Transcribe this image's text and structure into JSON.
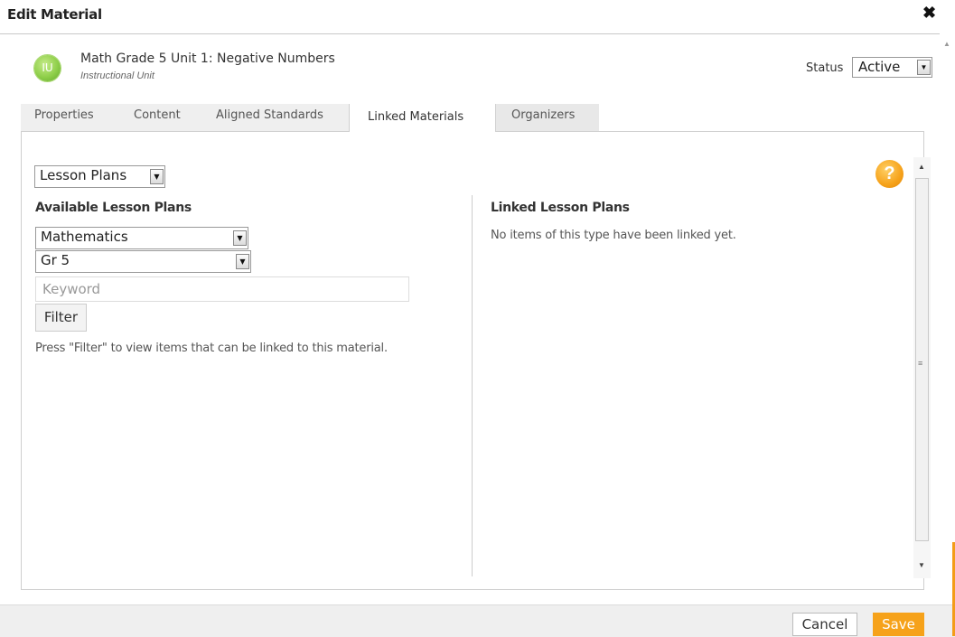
{
  "dialog": {
    "title": "Edit Material",
    "close_icon": "close-icon"
  },
  "material": {
    "avatar_text": "IU",
    "title": "Math Grade 5 Unit 1: Negative Numbers",
    "type": "Instructional Unit",
    "avatar_color": "#8fcf4a"
  },
  "status": {
    "label": "Status",
    "selected": "Active"
  },
  "tabs": [
    {
      "label": "Properties",
      "active": false
    },
    {
      "label": "Content",
      "active": false
    },
    {
      "label": "Aligned Standards",
      "active": false
    },
    {
      "label": "Linked Materials",
      "active": true
    },
    {
      "label": "Organizers",
      "active": false
    }
  ],
  "linked_materials": {
    "type_select": "Lesson Plans",
    "help_icon": "help-icon",
    "available": {
      "title": "Available Lesson Plans",
      "subject_select": "Mathematics",
      "grade_select": "Gr 5",
      "keyword_placeholder": "Keyword",
      "keyword_value": "",
      "filter_label": "Filter",
      "hint": "Press \"Filter\" to view items that can be linked to this material."
    },
    "linked": {
      "title": "Linked Lesson Plans",
      "empty_message": "No items of this type have been linked yet."
    }
  },
  "footer": {
    "cancel_label": "Cancel",
    "save_label": "Save"
  },
  "colors": {
    "accent": "#f6a21a",
    "avatar": "#8fcf4a"
  }
}
